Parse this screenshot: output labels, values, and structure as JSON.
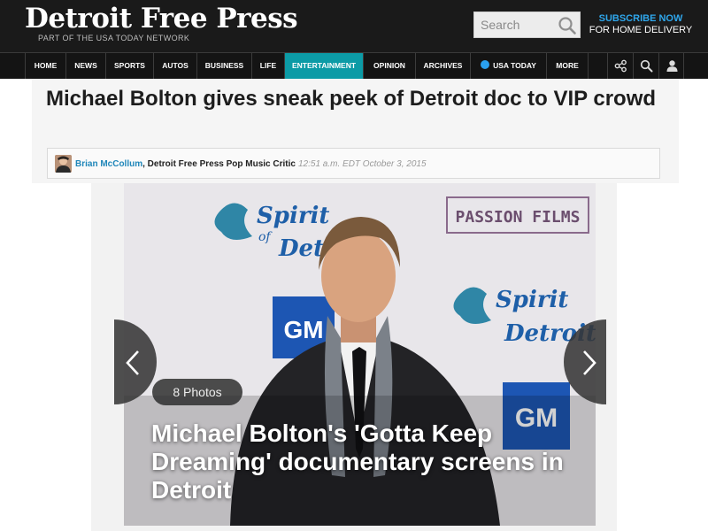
{
  "header": {
    "brand": "Detroit Free Press",
    "tagline": "PART OF THE USA TODAY NETWORK",
    "search_placeholder": "Search",
    "subscribe_line1": "SUBSCRIBE NOW",
    "subscribe_line2": "FOR HOME DELIVERY"
  },
  "nav": {
    "items": [
      "HOME",
      "NEWS",
      "SPORTS",
      "AUTOS",
      "BUSINESS",
      "LIFE",
      "ENTERTAINMENT",
      "OPINION",
      "ARCHIVES",
      "USA TODAY",
      "MORE"
    ],
    "active": "ENTERTAINMENT",
    "icons": [
      "share-icon",
      "search-icon",
      "user-icon"
    ]
  },
  "article": {
    "headline": "Michael Bolton gives sneak peek of Detroit doc to VIP crowd",
    "author_name": "Brian McCollum",
    "author_role": ", Detroit Free Press Pop Music Critic",
    "timestamp": "12:51 a.m. EDT October 3, 2015"
  },
  "gallery": {
    "photo_count": "8 Photos",
    "title": "Michael Bolton's 'Gotta Keep Dreaming' documentary screens in Detroit",
    "backdrop_text": [
      "PASSION FILMS",
      "Spirit",
      "of",
      "Detroit",
      "GM"
    ]
  },
  "colors": {
    "masthead": "#1a1a1a",
    "accent_teal": "#0c9ba6",
    "link_blue": "#1f86b9",
    "subscribe_blue": "#2fa7ec"
  }
}
